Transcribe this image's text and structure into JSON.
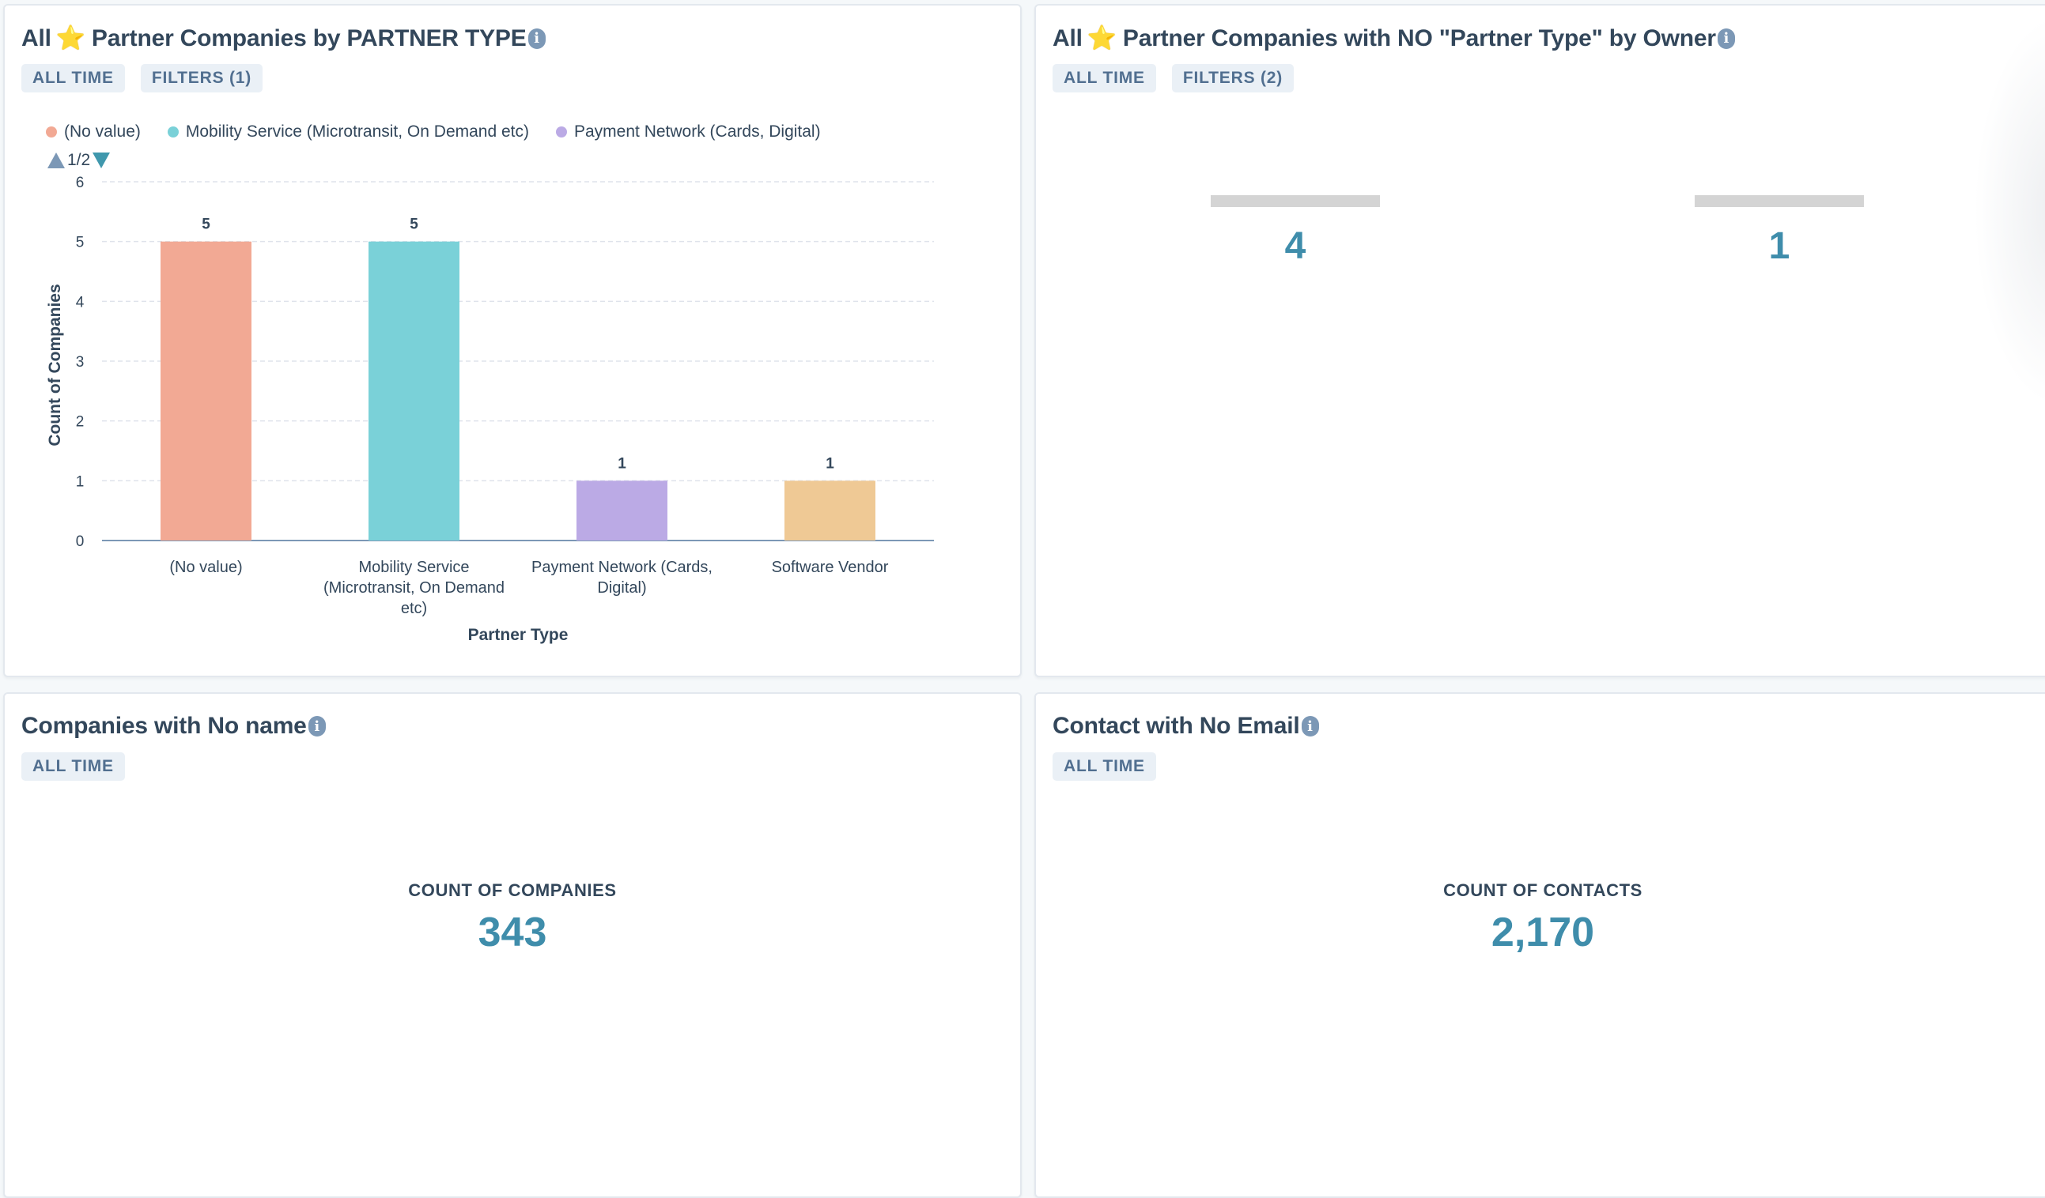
{
  "cards": [
    {
      "title_prefix": "All",
      "title_star": "⭐",
      "title_rest": "Partner Companies by PARTNER TYPE",
      "info_icon": "i",
      "tags": [
        "ALL TIME",
        "FILTERS (1)"
      ]
    },
    {
      "title_prefix": "All",
      "title_star": "⭐",
      "title_rest": "Partner Companies with NO \"Partner Type\" by Owner",
      "info_icon": "i",
      "tags": [
        "ALL TIME",
        "FILTERS (2)"
      ],
      "owners": [
        {
          "name_redacted": true,
          "value": "4"
        },
        {
          "name_redacted": true,
          "value": "1"
        }
      ]
    },
    {
      "title": "Companies with No name",
      "info_icon": "i",
      "tags": [
        "ALL TIME"
      ],
      "kpi_label": "COUNT OF COMPANIES",
      "kpi_value": "343"
    },
    {
      "title": "Contact with No Email",
      "info_icon": "i",
      "tags": [
        "ALL TIME"
      ],
      "kpi_label": "COUNT OF CONTACTS",
      "kpi_value": "2,170"
    }
  ],
  "legend": {
    "items": [
      {
        "label": "(No value)",
        "color": "#f2a994"
      },
      {
        "label": "Mobility Service (Microtransit, On Demand etc)",
        "color": "#7ad1d8"
      },
      {
        "label": "Payment Network (Cards, Digital)",
        "color": "#bbaae5"
      }
    ],
    "pager": "1/2"
  },
  "chart_data": {
    "type": "bar",
    "title": "All ⭐ Partner Companies by PARTNER TYPE",
    "xlabel": "Partner Type",
    "ylabel": "Count of Companies",
    "categories": [
      [
        "(No value)"
      ],
      [
        "Mobility Service",
        "(Microtransit, On Demand",
        "etc)"
      ],
      [
        "Payment Network (Cards,",
        "Digital)"
      ],
      [
        "Software Vendor"
      ]
    ],
    "category_names": [
      "(No value)",
      "Mobility Service (Microtransit, On Demand etc)",
      "Payment Network (Cards, Digital)",
      "Software Vendor"
    ],
    "values": [
      5,
      5,
      1,
      1
    ],
    "colors": [
      "#f2a994",
      "#7ad1d8",
      "#bbaae5",
      "#efc995"
    ],
    "yticks": [
      0,
      1,
      2,
      3,
      4,
      5,
      6
    ],
    "ylim": [
      0,
      6
    ],
    "grid": true,
    "data_labels": true,
    "legend_position": "top-left"
  }
}
